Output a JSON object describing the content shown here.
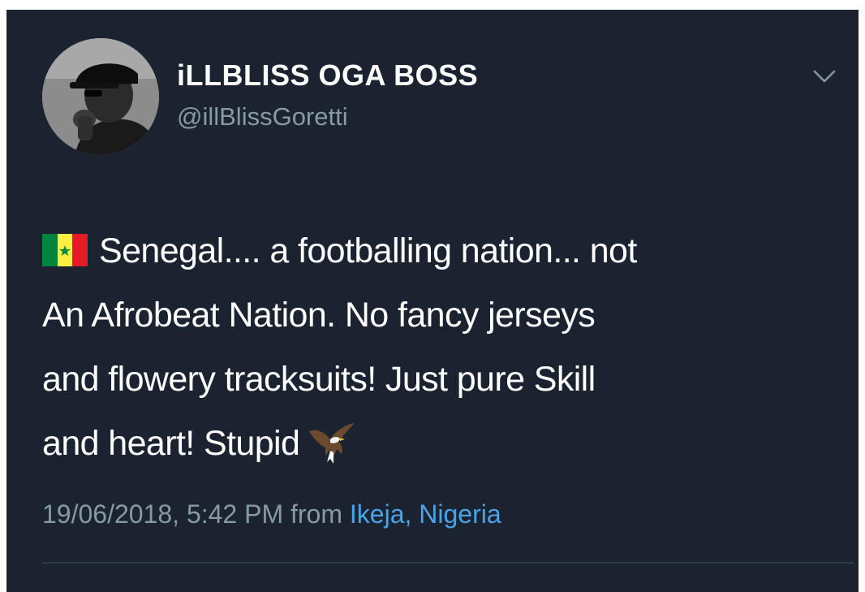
{
  "tweet": {
    "display_name": "iLLBLISS OGA BOSS",
    "handle": "@illBlissGoretti",
    "lines": [
      "Senegal.... a footballing nation... not",
      "An Afrobeat Nation. No fancy jerseys",
      "and flowery tracksuits! Just pure Skill",
      "and heart! Stupid"
    ],
    "timestamp": "19/06/2018, 5:42 PM",
    "from_label": "from",
    "location": "Ikeja, Nigeria",
    "leading_emoji": "senegal-flag-icon",
    "trailing_emoji": "eagle-icon"
  },
  "colors": {
    "background": "#1b2330",
    "text": "#ffffff",
    "secondary_text": "#8899a6",
    "link": "#4aa3e8",
    "flag_green": "#00853f",
    "flag_yellow": "#fdef42",
    "flag_red": "#e31b23"
  }
}
